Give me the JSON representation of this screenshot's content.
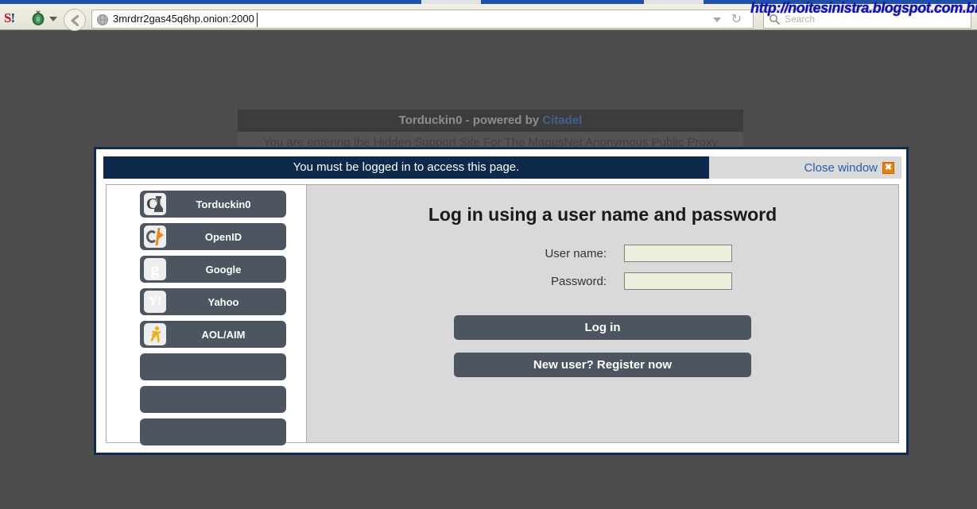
{
  "browser": {
    "favicon_s": "S",
    "favicon_s_bang": "!",
    "tor_icon": "onion-icon",
    "back_icon": "back-arrow-icon",
    "url_value": "3mrdrr2gas45q6hp.onion:2000",
    "url_globe_icon": "globe-icon",
    "reload_glyph": "↻",
    "search_placeholder": "Search",
    "search_icon": "magnifier-icon"
  },
  "watermark": {
    "text": "http://noitesinistra.blogspot.com.br/",
    "color": "#1212a8"
  },
  "background_page": {
    "header_prefix": "Torduckin0 - powered by ",
    "header_brand": "Citadel",
    "subtitle": "You are entering the Hidden Support Site For The MagusNet Anonymous Public Proxy"
  },
  "modal": {
    "title": "You must be logged in to access this page.",
    "close_label": "Close window",
    "close_icon_glyph": "✖",
    "title_bg": "#0d2a4d",
    "accent_link": "#2a5db0",
    "close_icon_bg": "#e8820c"
  },
  "sidebar": {
    "providers": [
      {
        "label": "Torduckin0",
        "icon": "citadel-icon"
      },
      {
        "label": "OpenID",
        "icon": "openid-icon"
      },
      {
        "label": "Google",
        "icon": "google-icon",
        "glyph": "g"
      },
      {
        "label": "Yahoo",
        "icon": "yahoo-icon",
        "glyph": "Y!"
      },
      {
        "label": "AOL/AIM",
        "icon": "aol-running-man-icon"
      }
    ],
    "blank_slots": 3
  },
  "login_form": {
    "heading": "Log in using a user name and password",
    "username_label": "User name:",
    "username_value": "",
    "username_placeholder": "",
    "password_label": "Password:",
    "password_value": "",
    "password_placeholder": "",
    "login_button": "Log in",
    "register_button": "New user? Register now",
    "button_bg": "#4c5560",
    "input_bg": "#eeeedd"
  }
}
